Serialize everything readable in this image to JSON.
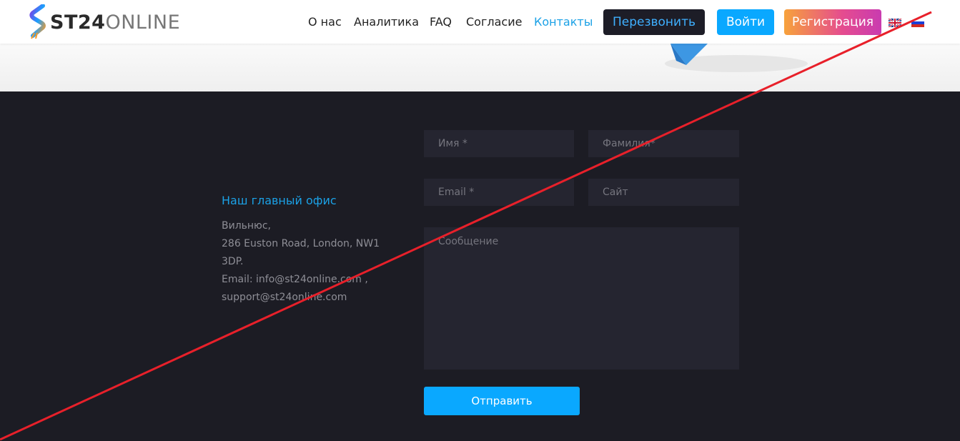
{
  "header": {
    "logo": {
      "bold": "ST24",
      "light": "ONLINE"
    },
    "nav": [
      "О нас",
      "Аналитика",
      "FAQ",
      "Согласие",
      "Контакты"
    ],
    "active_nav": "Контакты",
    "call_button": "Перезвонить",
    "login_button": "Войти",
    "register_button": "Регистрация",
    "languages": [
      "en-flag-icon",
      "ru-flag-icon"
    ]
  },
  "office": {
    "title": "Наш главный офис",
    "city": "Вильнюс,",
    "address_line1": "286 Euston Road, London, NW1",
    "address_line2": "3DP.",
    "email_line": "Email: info@st24online.com ,",
    "support_line": "support@st24online.com"
  },
  "form": {
    "first_name_placeholder": "Имя *",
    "last_name_placeholder": "Фамилия*",
    "email_placeholder": "Email *",
    "site_placeholder": "Сайт",
    "message_placeholder": "Сообщение",
    "submit_label": "Отправить"
  },
  "colors": {
    "accent": "#0aa8ff",
    "link_active": "#1ba1e6",
    "dark_bg": "#1c1c24",
    "field_bg": "#252530",
    "strike_line": "#e8202a"
  }
}
